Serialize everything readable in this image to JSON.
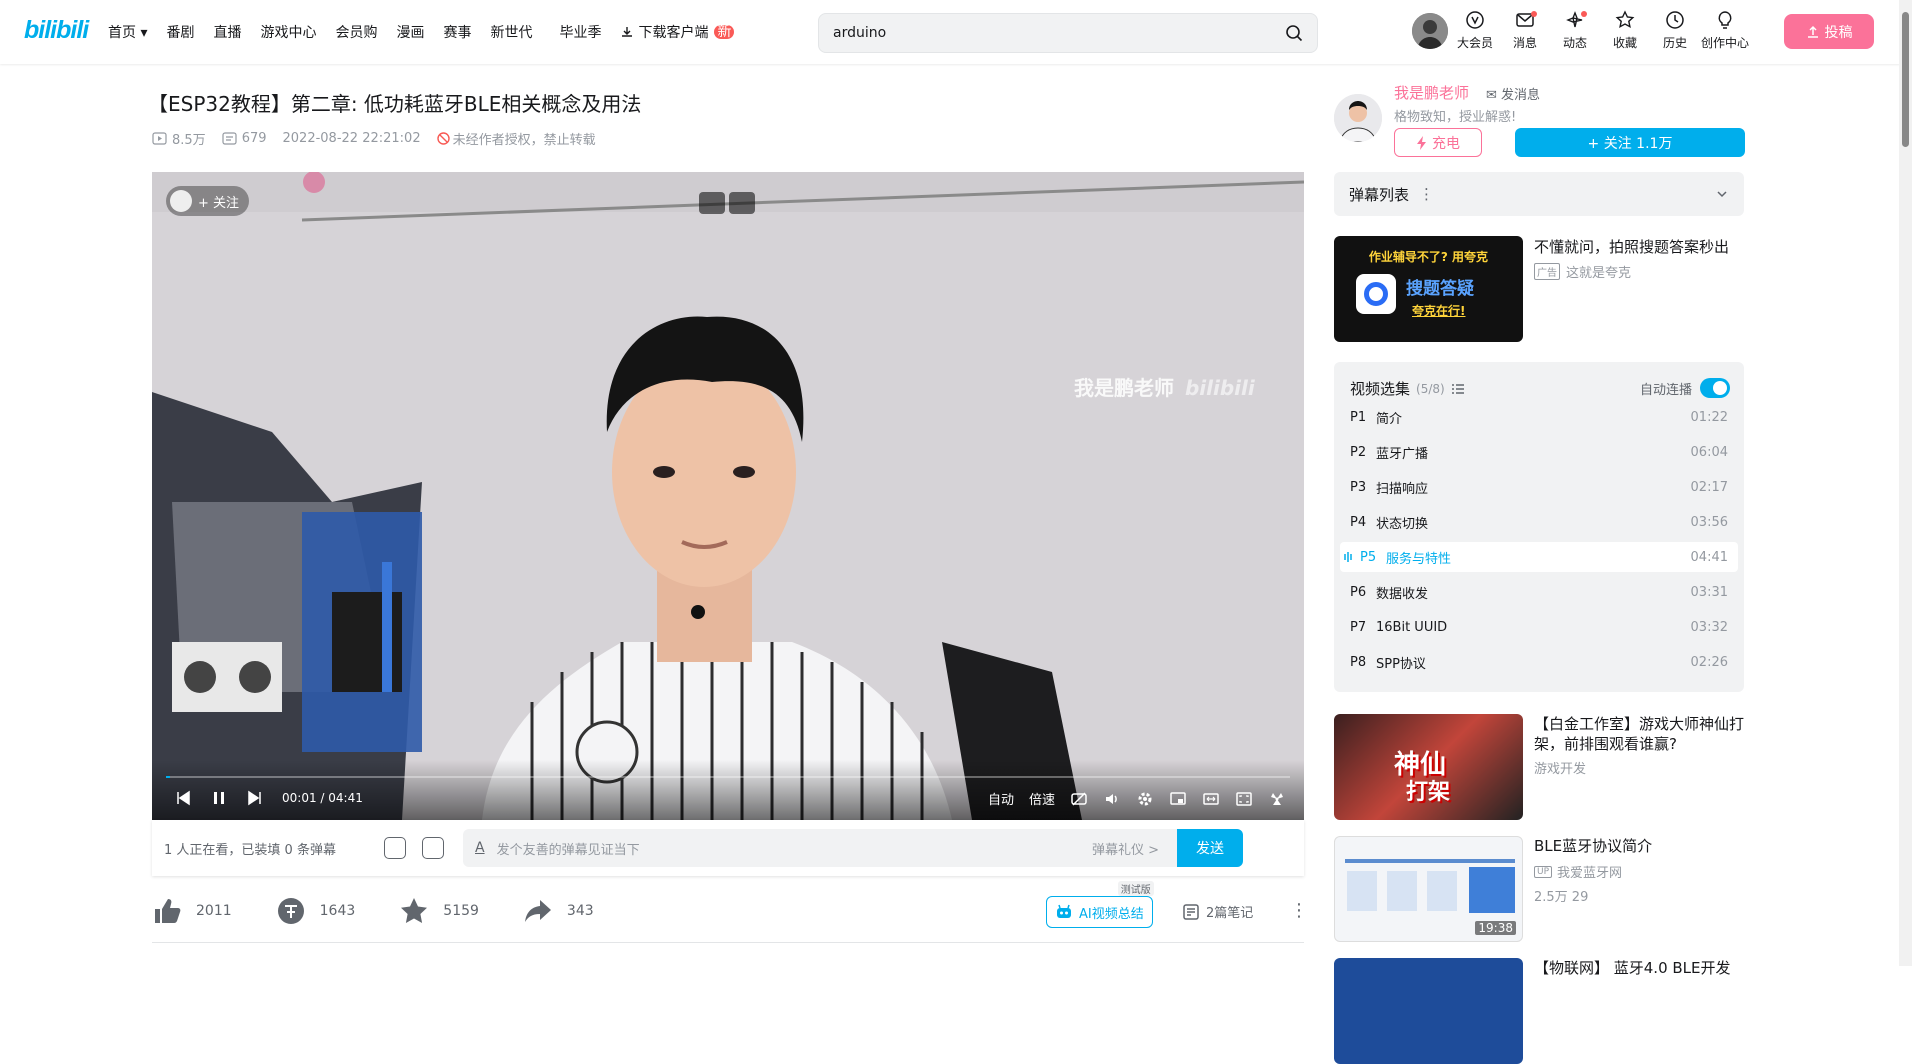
{
  "header": {
    "logo": "bilibili",
    "nav": [
      "首页",
      "番剧",
      "直播",
      "游戏中心",
      "会员购",
      "漫画",
      "赛事",
      "新世代",
      "毕业季"
    ],
    "download": "下载客户端",
    "new_badge": "新",
    "search_value": "arduino",
    "icons": [
      {
        "label": "大会员",
        "icon": "vip-icon",
        "dot": false
      },
      {
        "label": "消息",
        "icon": "message-icon",
        "dot": true
      },
      {
        "label": "动态",
        "icon": "dynamic-icon",
        "dot": true
      },
      {
        "label": "收藏",
        "icon": "star-icon",
        "dot": false
      },
      {
        "label": "历史",
        "icon": "history-icon",
        "dot": false
      },
      {
        "label": "创作中心",
        "icon": "lightbulb-icon",
        "dot": false
      }
    ],
    "upload": "投稿",
    "accent": "#00aeec",
    "pink": "#fb7299"
  },
  "video": {
    "title": "【ESP32教程】第二章: 低功耗蓝牙BLE相关概念及用法",
    "views": "8.5万",
    "danmaku": "679",
    "date": "2022-08-22 22:21:02",
    "notice": "未经作者授权，禁止转载"
  },
  "player": {
    "watermark": "我是鹏老师",
    "watermark_logo": "bilibili",
    "follow": "+ 关注",
    "time": "00:01 / 04:41",
    "progress": 0.004,
    "auto": "自动",
    "speed": "倍速"
  },
  "danmaku_bar": {
    "count": "1 人正在看，已装填 0 条弹幕",
    "placeholder": "发个友善的弹幕见证当下",
    "gift": "弹幕礼仪 >",
    "send": "发送"
  },
  "toolbar": {
    "like": "2011",
    "coin": "1643",
    "fav": "5159",
    "share": "343",
    "ai": "AI视频总结",
    "ai_tag": "测试版",
    "notes": "2篇笔记"
  },
  "uploader": {
    "name": "我是鹏老师",
    "message": "发消息",
    "desc": "格物致知，授业解惑!",
    "charge": "充电",
    "follow": "+ 关注 1.1万"
  },
  "danmaku_list": "弹幕列表",
  "ad": {
    "title": "不懂就问，拍照搜题答案秒出",
    "badge": "广告",
    "source": "这就是夸克",
    "img_line1": "作业辅导不了? 用夸克",
    "img_line2": "搜题答疑",
    "img_line3": "夸克在行!"
  },
  "playlist": {
    "title": "视频选集",
    "count": "(5/8)",
    "autoplay": "自动连播",
    "items": [
      {
        "p": "P1",
        "title": "简介",
        "dur": "01:22"
      },
      {
        "p": "P2",
        "title": "蓝牙广播",
        "dur": "06:04"
      },
      {
        "p": "P3",
        "title": "扫描响应",
        "dur": "02:17"
      },
      {
        "p": "P4",
        "title": "状态切换",
        "dur": "03:56"
      },
      {
        "p": "P5",
        "title": "服务与特性",
        "dur": "04:41"
      },
      {
        "p": "P6",
        "title": "数据收发",
        "dur": "03:31"
      },
      {
        "p": "P7",
        "title": "16Bit UUID",
        "dur": "03:32"
      },
      {
        "p": "P8",
        "title": "SPP协议",
        "dur": "02:26"
      }
    ]
  },
  "recommend": [
    {
      "title": "【白金工作室】游戏大师神仙打架，前排围观看谁赢?",
      "up": "游戏开发",
      "stats": "",
      "dur": ""
    },
    {
      "title": "BLE蓝牙协议简介",
      "up": "我爱蓝牙网",
      "stats": "2.5万   29",
      "dur": "19:38"
    },
    {
      "title": "【物联网】 蓝牙4.0 BLE开发",
      "up": "",
      "stats": "",
      "dur": ""
    }
  ]
}
